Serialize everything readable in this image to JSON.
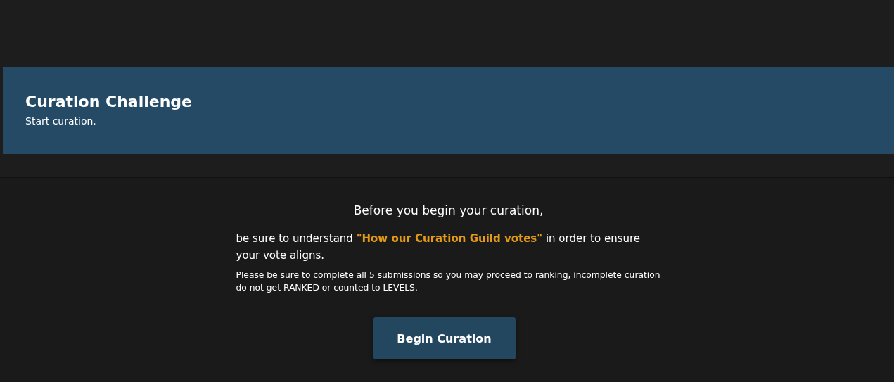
{
  "header": {
    "title": "Curation Challenge",
    "subtitle": "Start curation."
  },
  "intro": {
    "heading": "Before you begin your curation,",
    "text_before": "be sure to understand ",
    "link": "\"How our Curation Guild votes\"",
    "text_after": " in order to ensure your vote aligns.",
    "note": "Please be sure to complete all 5 submissions so you may proceed to ranking, incomplete curation do not get RANKED or counted to LEVELS."
  },
  "button": {
    "label": "Begin Curation"
  }
}
